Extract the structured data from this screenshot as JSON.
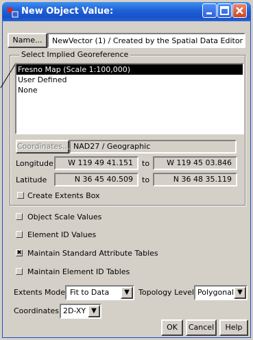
{
  "window": {
    "title": "New Object Value:",
    "icon": "vector-object-icon"
  },
  "name_row": {
    "button_label": "Name...",
    "value": "NewVector (1) / Created by the Spatial Data Editor"
  },
  "georeference": {
    "group_label": "Select Implied Georeference",
    "items": [
      {
        "label": "Fresno Map (Scale 1:100,000)",
        "selected": true
      },
      {
        "label": "User Defined",
        "selected": false
      },
      {
        "label": "None",
        "selected": false
      }
    ],
    "coordinates_button": "Coordinates...",
    "coordinates_value": "NAD27 / Geographic",
    "longitude_label": "Longitude",
    "longitude_from": "W 119 49 41.151",
    "longitude_to": "W 119 45 03.846",
    "latitude_label": "Latitude",
    "latitude_from": "N 36 45 40.509",
    "latitude_to": "N 36 48 35.119",
    "to_label": "to",
    "create_extents_label": "Create Extents Box",
    "create_extents_checked": false
  },
  "options": [
    {
      "label": "Object Scale Values",
      "checked": false
    },
    {
      "label": "Element ID Values",
      "checked": false
    },
    {
      "label": "Maintain Standard Attribute Tables",
      "checked": true
    },
    {
      "label": "Maintain Element ID Tables",
      "checked": false
    }
  ],
  "extents_mode": {
    "label": "Extents Mode:",
    "value": "Fit to Data"
  },
  "topology_level": {
    "label": "Topology Level",
    "value": "Polygonal"
  },
  "coordinates": {
    "label": "Coordinates",
    "value": "2D-XY"
  },
  "buttons": {
    "ok": "OK",
    "cancel": "Cancel",
    "help": "Help"
  },
  "check_mark": "✖",
  "dropdown_glyph": "▼"
}
